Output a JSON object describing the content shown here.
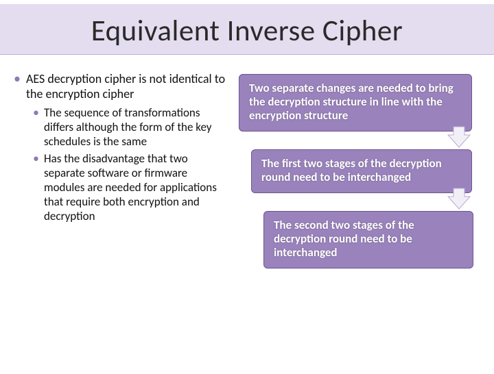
{
  "title": "Equivalent Inverse Cipher",
  "left": {
    "main": "AES decryption cipher is not identical to the encryption cipher",
    "sub1": "The sequence of transformations differs although the form of the key schedules is the same",
    "sub2": "Has the disadvantage that two separate software or firmware modules are needed for applications that require both encryption and decryption"
  },
  "boxes": {
    "b1": "Two separate changes are needed to bring the decryption structure in line with the encryption structure",
    "b2": "The first two stages of the decryption round need to be interchanged",
    "b3": "The second two stages of the decryption round need to be interchanged"
  }
}
